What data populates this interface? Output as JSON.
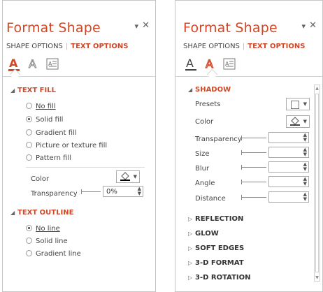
{
  "left_pane": {
    "title": "Format Shape",
    "tabs": [
      "SHAPE OPTIONS",
      "TEXT OPTIONS"
    ],
    "active_tab": "TEXT OPTIONS",
    "icons": [
      "text-fill-outline-icon",
      "text-effects-icon",
      "textbox-icon"
    ],
    "text_fill": {
      "header": "TEXT FILL",
      "options": [
        {
          "label": "No fill",
          "selected": false
        },
        {
          "label": "Solid fill",
          "selected": true
        },
        {
          "label": "Gradient fill",
          "selected": false
        },
        {
          "label": "Picture or texture fill",
          "selected": false
        },
        {
          "label": "Pattern fill",
          "selected": false
        }
      ],
      "color_label": "Color",
      "transparency_label": "Transparency",
      "transparency_value": "0%"
    },
    "text_outline": {
      "header": "TEXT OUTLINE",
      "options": [
        {
          "label": "No line",
          "selected": true
        },
        {
          "label": "Solid line",
          "selected": false
        },
        {
          "label": "Gradient line",
          "selected": false
        }
      ]
    }
  },
  "right_pane": {
    "title": "Format Shape",
    "tabs": [
      "SHAPE OPTIONS",
      "TEXT OPTIONS"
    ],
    "active_tab": "TEXT OPTIONS",
    "icons": [
      "text-fill-outline-icon",
      "text-effects-icon",
      "textbox-icon"
    ],
    "shadow": {
      "header": "SHADOW",
      "presets_label": "Presets",
      "color_label": "Color",
      "transparency_label": "Transparency",
      "size_label": "Size",
      "blur_label": "Blur",
      "angle_label": "Angle",
      "distance_label": "Distance"
    },
    "collapsed_sections": [
      "REFLECTION",
      "GLOW",
      "SOFT EDGES",
      "3-D FORMAT",
      "3-D ROTATION"
    ]
  },
  "colors": {
    "accent": "#d24726",
    "text": "#444444",
    "border": "#c6c6c6"
  }
}
